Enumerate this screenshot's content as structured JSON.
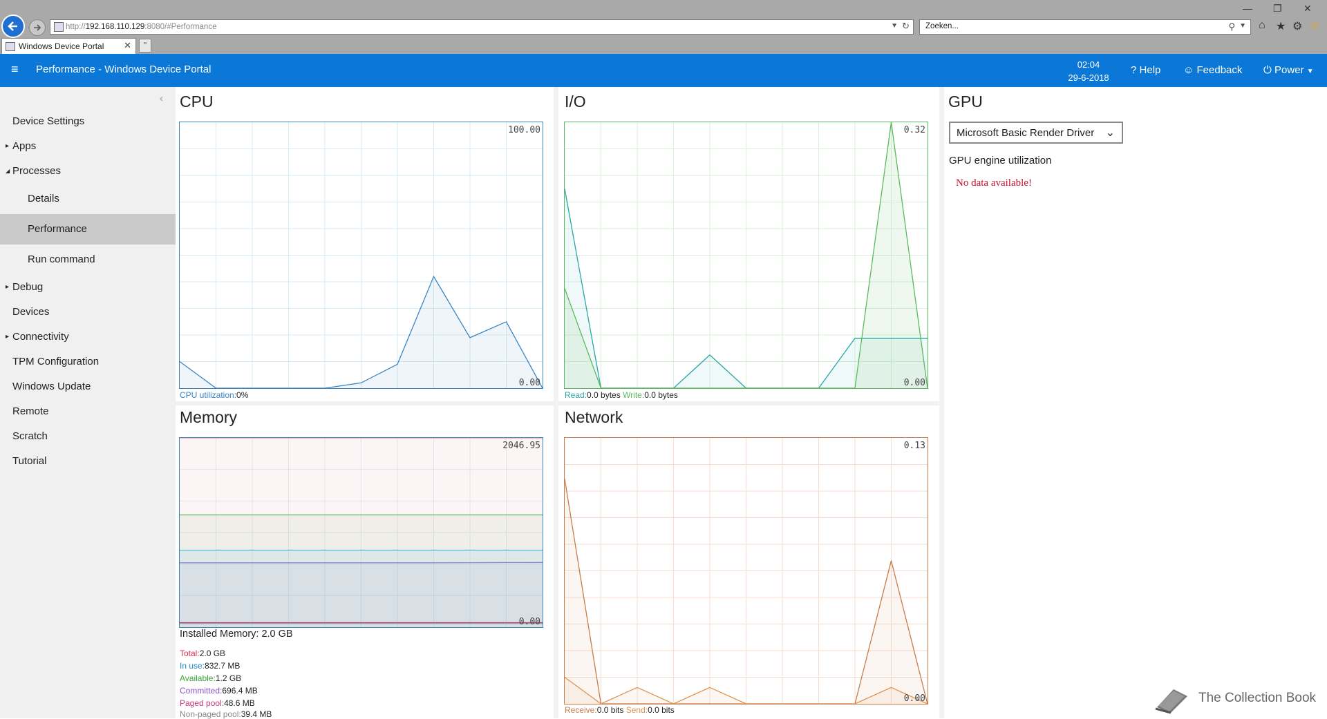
{
  "browser": {
    "url_prefix": "http://",
    "url_host": "192.168.110.129",
    "url_suffix": ":8080/#Performance",
    "search_placeholder": "Zoeken...",
    "tab_title": "Windows Device Portal"
  },
  "header": {
    "title": "Performance - Windows Device Portal",
    "time": "02:04",
    "date": "29-6-2018",
    "help_label": "Help",
    "feedback_label": "Feedback",
    "power_label": "Power"
  },
  "sidebar": {
    "items": [
      {
        "label": "Device Settings",
        "caret": ""
      },
      {
        "label": "Apps",
        "caret": "▸"
      },
      {
        "label": "Processes",
        "caret": "◢"
      },
      {
        "label": "Details",
        "caret": ""
      },
      {
        "label": "Performance",
        "caret": ""
      },
      {
        "label": "Run command",
        "caret": ""
      },
      {
        "label": "Debug",
        "caret": "▸"
      },
      {
        "label": "Devices",
        "caret": ""
      },
      {
        "label": "Connectivity",
        "caret": "▸"
      },
      {
        "label": "TPM Configuration",
        "caret": ""
      },
      {
        "label": "Windows Update",
        "caret": ""
      },
      {
        "label": "Remote",
        "caret": ""
      },
      {
        "label": "Scratch",
        "caret": ""
      },
      {
        "label": "Tutorial",
        "caret": ""
      }
    ],
    "active": "Performance"
  },
  "cpu": {
    "title": "CPU",
    "max_label": "100.00",
    "min_label": "0.00",
    "util_label": "CPU utilization:",
    "util_value": "0%"
  },
  "io": {
    "title": "I/O",
    "max_label": "0.32",
    "min_label": "0.00",
    "read_label": "Read:",
    "read_value": "0.0 bytes",
    "write_label": "Write:",
    "write_value": "0.0 bytes"
  },
  "memory": {
    "title": "Memory",
    "max_label": "2046.95",
    "min_label": "0.00",
    "installed": "Installed Memory: 2.0 GB",
    "rows": [
      {
        "label": "Total:",
        "value": "2.0 GB",
        "color": "#d9304c"
      },
      {
        "label": "In use:",
        "value": "832.7 MB",
        "color": "#1b8ec9"
      },
      {
        "label": "Available:",
        "value": "1.2 GB",
        "color": "#3aa63a"
      },
      {
        "label": "Committed:",
        "value": "696.4 MB",
        "color": "#8b55c9"
      },
      {
        "label": "Paged pool:",
        "value": "48.6 MB",
        "color": "#c0397a"
      },
      {
        "label": "Non-paged pool:",
        "value": "39.4 MB",
        "color": "#888888"
      }
    ]
  },
  "network": {
    "title": "Network",
    "max_label": "0.13",
    "min_label": "0.00",
    "receive_label": "Receive:",
    "receive_value": "0.0 bits",
    "send_label": "Send:",
    "send_value": "0.0 bits"
  },
  "gpu": {
    "title": "GPU",
    "selected_adapter": "Microsoft Basic Render Driver",
    "engine_label": "GPU engine utilization",
    "no_data": "No data available!"
  },
  "watermark": "The Collection Book",
  "colors": {
    "accent": "#0b78d7",
    "cpu": "#3a84c4",
    "io_read": "#2aa6a6",
    "io_write": "#5cb85c",
    "net": "#c97b4a",
    "error": "#c8102e"
  },
  "chart_data": [
    {
      "type": "area",
      "title": "CPU",
      "x": [
        0,
        1,
        2,
        3,
        4,
        5,
        6,
        7,
        8,
        9,
        10
      ],
      "series": [
        {
          "name": "CPU utilization",
          "values": [
            10,
            0,
            0,
            0,
            0,
            2,
            9,
            42,
            19,
            25,
            0
          ]
        }
      ],
      "ylim": [
        0,
        100
      ]
    },
    {
      "type": "area",
      "title": "I/O",
      "x": [
        0,
        1,
        2,
        3,
        4,
        5,
        6,
        7,
        8,
        9,
        10
      ],
      "series": [
        {
          "name": "Read",
          "values": [
            0.24,
            0.0,
            0.0,
            0.0,
            0.04,
            0.0,
            0.0,
            0.0,
            0.06,
            0.06,
            0.06
          ]
        },
        {
          "name": "Write",
          "values": [
            0.12,
            0.0,
            0.0,
            0.0,
            0.0,
            0.0,
            0.0,
            0.0,
            0.0,
            0.32,
            0.0
          ]
        }
      ],
      "ylim": [
        0,
        0.32
      ]
    },
    {
      "type": "area",
      "title": "Memory",
      "x": [
        0,
        1,
        2,
        3,
        4,
        5,
        6,
        7,
        8,
        9,
        10
      ],
      "series": [
        {
          "name": "Total",
          "values": [
            2046.95,
            2046.95,
            2046.95,
            2046.95,
            2046.95,
            2046.95,
            2046.95,
            2046.95,
            2046.95,
            2046.95,
            2046.95
          ]
        },
        {
          "name": "Available",
          "values": [
            1214,
            1214,
            1214,
            1214,
            1214,
            1214,
            1214,
            1214,
            1214,
            1214,
            1214
          ]
        },
        {
          "name": "In use",
          "values": [
            832.7,
            832.7,
            832.7,
            832.7,
            832.7,
            832.7,
            832.7,
            832.7,
            832.7,
            832.7,
            832.7
          ]
        },
        {
          "name": "Committed",
          "values": [
            696.4,
            696.4,
            696.4,
            696.4,
            696.4,
            696.4,
            696.4,
            696.4,
            698,
            699,
            700
          ]
        },
        {
          "name": "Paged pool",
          "values": [
            48.6,
            48.6,
            48.6,
            48.6,
            48.6,
            48.6,
            48.6,
            48.6,
            48.6,
            48.6,
            48.6
          ]
        },
        {
          "name": "Non-paged pool",
          "values": [
            39.4,
            39.4,
            39.4,
            39.4,
            39.4,
            39.4,
            39.4,
            39.4,
            39.4,
            39.4,
            39.4
          ]
        }
      ],
      "ylim": [
        0,
        2046.95
      ]
    },
    {
      "type": "area",
      "title": "Network",
      "x": [
        0,
        1,
        2,
        3,
        4,
        5,
        6,
        7,
        8,
        9,
        10
      ],
      "series": [
        {
          "name": "Receive",
          "values": [
            0.11,
            0.0,
            0.0,
            0.0,
            0.0,
            0.0,
            0.0,
            0.0,
            0.0,
            0.07,
            0.0
          ]
        },
        {
          "name": "Send",
          "values": [
            0.013,
            0.0,
            0.008,
            0.0,
            0.008,
            0.0,
            0.0,
            0.0,
            0.0,
            0.008,
            0.0
          ]
        }
      ],
      "ylim": [
        0,
        0.13
      ]
    }
  ]
}
